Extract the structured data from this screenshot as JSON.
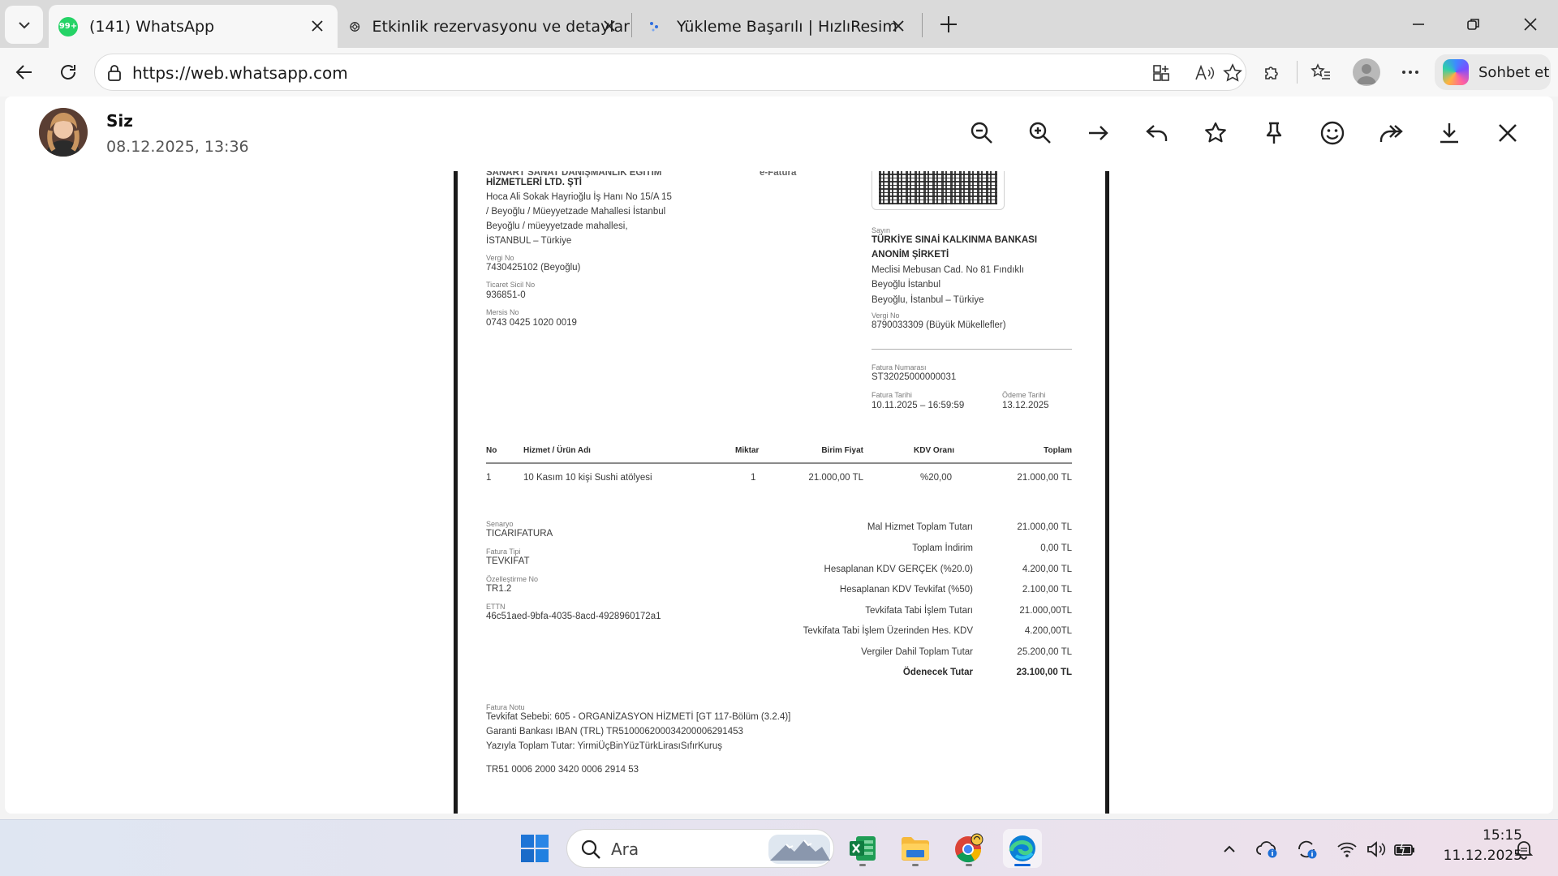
{
  "browser": {
    "tabs": [
      {
        "title": "(141) WhatsApp",
        "badge": "99+",
        "icon": "whatsapp-icon",
        "active": true
      },
      {
        "title": "Etkinlik rezervasyonu ve detaylar",
        "icon": "chatgpt-icon",
        "active": false
      },
      {
        "title": "Yükleme Başarılı | HızlıResim",
        "icon": "hizliresim-icon",
        "active": false
      }
    ],
    "url": "https://web.whatsapp.com",
    "copilot_label": "Sohbet et"
  },
  "viewer": {
    "sender_name": "Siz",
    "timestamp": "08.12.2025, 13:36",
    "actions": [
      "zoom-out-icon",
      "zoom-in-icon",
      "arrow-right-icon",
      "reply-icon",
      "star-icon",
      "pin-icon",
      "emoji-icon",
      "forward-icon",
      "download-icon",
      "close-icon"
    ]
  },
  "invoice": {
    "seller": {
      "name_partial": "SANART SANAT DANIŞMANLIK EĞİTİM",
      "name_line2": "HİZMETLERİ LTD. ŞTİ",
      "address": [
        "Hoca Ali Sokak Hayrioğlu İş Hanı No 15/A 15",
        "/ Beyoğlu / Müeyyetzade Mahallesi İstanbul",
        "Beyoğlu / müeyyetzade mahallesi,",
        "İSTANBUL – Türkiye"
      ],
      "tax_no_label": "Vergi No",
      "tax_no": "7430425102 (Beyoğlu)",
      "trade_reg_label": "Ticaret Sicil No",
      "trade_reg": "936851-0",
      "mersis_label": "Mersis No",
      "mersis": "0743 0425 1020 0019"
    },
    "doc_type": "e-Fatura",
    "buyer": {
      "label": "Sayın",
      "name": [
        "TÜRKİYE SINAİ KALKINMA BANKASI",
        "ANONİM ŞİRKETİ"
      ],
      "address": [
        "Meclisi Mebusan Cad. No 81 Fındıklı",
        "Beyoğlu İstanbul",
        "Beyoğlu, İstanbul – Türkiye"
      ],
      "tax_no_label": "Vergi No",
      "tax_no": "8790033309 (Büyük Mükellefler)"
    },
    "invoice_no_label": "Fatura Numarası",
    "invoice_no": "ST32025000000031",
    "invoice_date_label": "Fatura Tarihi",
    "invoice_date": "10.11.2025 – 16:59:59",
    "due_date_label": "Ödeme Tarihi",
    "due_date": "13.12.2025",
    "table": {
      "headers": [
        "No",
        "Hizmet / Ürün Adı",
        "Miktar",
        "Birim Fiyat",
        "KDV Oranı",
        "Toplam"
      ],
      "rows": [
        [
          "1",
          "10 Kasım 10 kişi Sushi atölyesi",
          "1",
          "21.000,00 TL",
          "%20,00",
          "21.000,00 TL"
        ]
      ]
    },
    "meta": [
      {
        "label": "Senaryo",
        "value": "TICARIFATURA"
      },
      {
        "label": "Fatura Tipi",
        "value": "TEVKIFAT"
      },
      {
        "label": "Özelleştirme No",
        "value": "TR1.2"
      },
      {
        "label": "ETTN",
        "value": "46c51aed-9bfa-4035-8acd-4928960172a1"
      }
    ],
    "totals": [
      {
        "label": "Mal Hizmet Toplam Tutarı",
        "value": "21.000,00 TL"
      },
      {
        "label": "Toplam İndirim",
        "value": "0,00 TL"
      },
      {
        "label": "Hesaplanan KDV GERÇEK (%20.0)",
        "value": "4.200,00 TL"
      },
      {
        "label": "Hesaplanan KDV Tevkifat (%50)",
        "value": "2.100,00 TL"
      },
      {
        "label": "Tevkifata Tabi İşlem Tutarı",
        "value": "21.000,00TL"
      },
      {
        "label": "Tevkifata Tabi İşlem Üzerinden Hes. KDV",
        "value": "4.200,00TL"
      },
      {
        "label": "Vergiler Dahil Toplam Tutar",
        "value": "25.200,00 TL"
      },
      {
        "label": "Ödenecek Tutar",
        "value": "23.100,00 TL"
      }
    ],
    "note_label": "Fatura Notu",
    "notes": [
      "Tevkifat Sebebi: 605 - ORGANİZASYON HİZMETİ [GT 117-Bölüm (3.2.4)]",
      "Garanti Bankası IBAN (TRL) TR510006200034200006291453",
      "Yazıyla Toplam Tutar: YirmiÜçBinYüzTürkLirasıSıfırKuruş"
    ],
    "iban_line": "TR51 0006 2000 3420 0006 2914 53"
  },
  "taskbar": {
    "search_label": "Ara",
    "time": "15:15",
    "date": "11.12.2025"
  }
}
